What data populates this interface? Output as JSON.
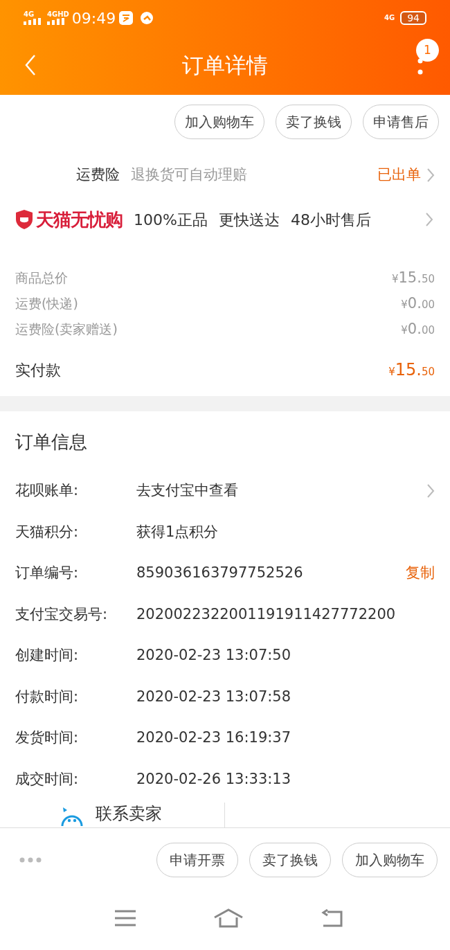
{
  "status_bar": {
    "network_1": "4G",
    "network_2": "4GHD",
    "time": "09:49",
    "network_3": "4G",
    "battery": "94"
  },
  "header": {
    "title": "订单详情",
    "badge": "1"
  },
  "top_actions": [
    "加入购物车",
    "卖了换钱",
    "申请售后"
  ],
  "insurance": {
    "label": "运费险",
    "description": "退换货可自动理赔",
    "status": "已出单"
  },
  "tmall": {
    "brand": "天猫无忧购",
    "features": [
      "100%正品",
      "更快送达",
      "48小时售后"
    ]
  },
  "prices": [
    {
      "label": "商品总价",
      "currency": "¥",
      "whole": "15.",
      "cents": "50",
      "kind": "minor"
    },
    {
      "label": "运费(快递)",
      "currency": "¥",
      "whole": "0.",
      "cents": "00",
      "kind": "minor"
    },
    {
      "label": "运费险(卖家赠送)",
      "currency": "¥",
      "whole": "0.",
      "cents": "00",
      "kind": "minor"
    },
    {
      "label": "实付款",
      "currency": "¥",
      "whole": "15.",
      "cents": "50",
      "kind": "total"
    }
  ],
  "order_info": {
    "title": "订单信息",
    "rows": [
      {
        "label": "花呗账单:",
        "value": "去支付宝中查看",
        "kind": "link"
      },
      {
        "label": "天猫积分:",
        "value": "获得1点积分",
        "kind": "plain"
      },
      {
        "label": "订单编号:",
        "value": "859036163797752526",
        "action": "复制",
        "kind": "copy"
      },
      {
        "label": "支付宝交易号:",
        "value": "2020022322001191911427772200",
        "kind": "plain"
      },
      {
        "label": "创建时间:",
        "value": "2020-02-23 13:07:50",
        "kind": "plain"
      },
      {
        "label": "付款时间:",
        "value": "2020-02-23 13:07:58",
        "kind": "plain"
      },
      {
        "label": "发货时间:",
        "value": "2020-02-23 16:19:37",
        "kind": "plain"
      },
      {
        "label": "成交时间:",
        "value": "2020-02-26 13:33:13",
        "kind": "plain"
      }
    ]
  },
  "contact": {
    "label": "联系卖家"
  },
  "bottom_actions": [
    "申请开票",
    "卖了换钱",
    "加入购物车"
  ]
}
